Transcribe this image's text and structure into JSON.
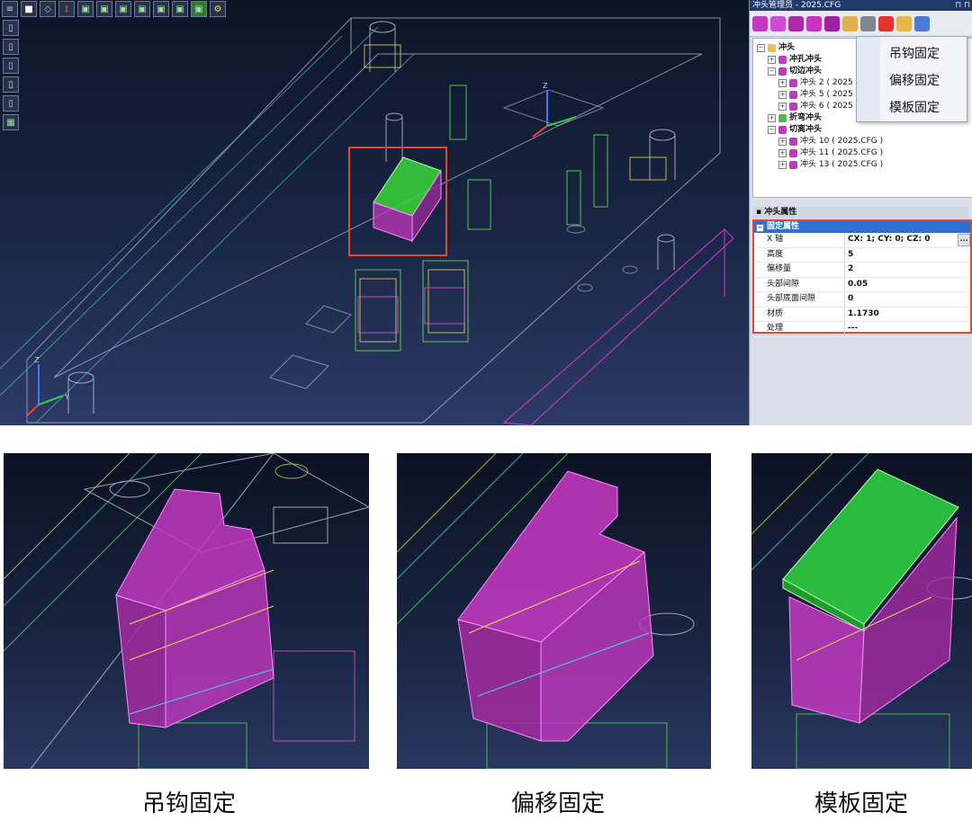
{
  "top_toolbar": [
    "menu-icon",
    "shaded-view-icon",
    "wireframe-view-icon",
    "axis-view-icon",
    "cube-front-icon",
    "cube-back-icon",
    "cube-left-icon",
    "cube-right-icon",
    "cube-top-icon",
    "cube-bottom-icon",
    "cube-iso-icon",
    "settings-icon"
  ],
  "left_toolbar": [
    "layer-icon-1",
    "layer-icon-2",
    "layer-icon-3",
    "layer-icon-4",
    "layer-icon-5",
    "layer-icon-6"
  ],
  "panel": {
    "title": "冲头管理员 - 2025.CFG",
    "pin": "⊓ ⊓"
  },
  "tree": [
    {
      "label": "冲头",
      "level": 0,
      "bold": true,
      "expander": "−",
      "color": "#e8c24a"
    },
    {
      "label": "冲孔冲头",
      "level": 1,
      "bold": true,
      "expander": "+",
      "color": "#c238c0"
    },
    {
      "label": "切边冲头",
      "level": 1,
      "bold": true,
      "expander": "−",
      "color": "#c238c0"
    },
    {
      "label": "冲头 2 ( 2025",
      "level": 2,
      "bold": false,
      "expander": "+",
      "color": "#c238c0"
    },
    {
      "label": "冲头 5 ( 2025",
      "level": 2,
      "bold": false,
      "expander": "+",
      "color": "#c238c0"
    },
    {
      "label": "冲头 6 ( 2025",
      "level": 2,
      "bold": false,
      "expander": "+",
      "color": "#c238c0"
    },
    {
      "label": "折弯冲头",
      "level": 1,
      "bold": true,
      "expander": "+",
      "color": "#4fb84f"
    },
    {
      "label": "切离冲头",
      "level": 1,
      "bold": true,
      "expander": "−",
      "color": "#c238c0"
    },
    {
      "label": "冲头 10 ( 2025.CFG )",
      "level": 2,
      "bold": false,
      "expander": "+",
      "color": "#c238c0"
    },
    {
      "label": "冲头 11 ( 2025.CFG )",
      "level": 2,
      "bold": false,
      "expander": "+",
      "color": "#c238c0"
    },
    {
      "label": "冲头 13 ( 2025.CFG )",
      "level": 2,
      "bold": false,
      "expander": "+",
      "color": "#c238c0"
    }
  ],
  "menu": [
    "吊钩固定",
    "偏移固定",
    "模板固定"
  ],
  "props_header": "冲头属性",
  "props_category": "固定属性",
  "props": [
    {
      "k": "X 轴",
      "v": "CX: 1; CY: 0; CZ: 0",
      "dots": "..."
    },
    {
      "k": "高度",
      "v": "5"
    },
    {
      "k": "偏移量",
      "v": "2"
    },
    {
      "k": "头部间隙",
      "v": "0.05"
    },
    {
      "k": "头部底面间隙",
      "v": "0"
    },
    {
      "k": "材质",
      "v": "1.1730"
    },
    {
      "k": "处理",
      "v": "---"
    }
  ],
  "captions": [
    "吊钩固定",
    "偏移固定",
    "模板固定"
  ],
  "axis_labels": {
    "z": "Z",
    "y": "Y"
  },
  "colors": {
    "selection": "#e0492d",
    "magenta": "#c238c0",
    "green": "#2ecc40",
    "accent_blue": "#2f6fd0"
  }
}
